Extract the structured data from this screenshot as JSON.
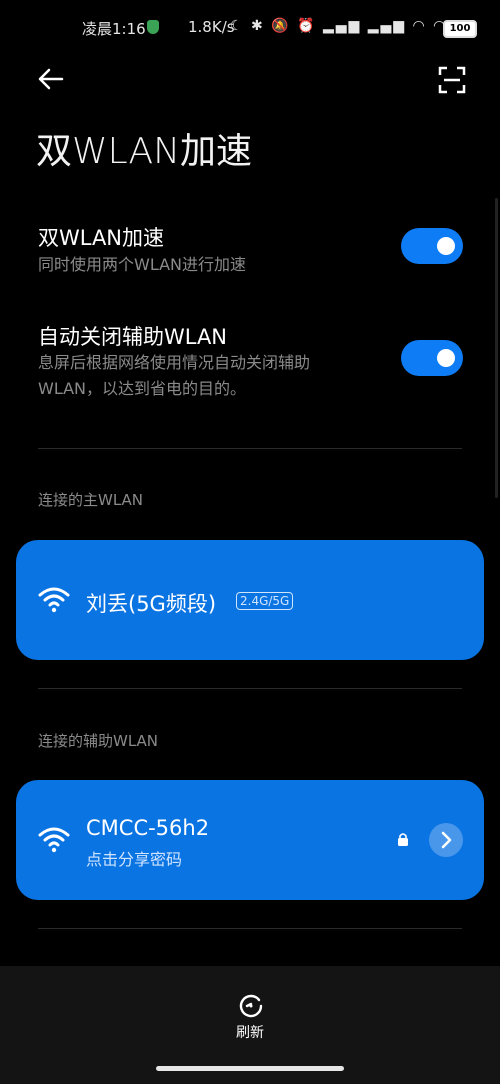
{
  "status_bar": {
    "time": "凌晨1:16",
    "net_speed": "1.8K/s",
    "battery": "100"
  },
  "page": {
    "title": "双WLAN加速"
  },
  "settings": [
    {
      "title": "双WLAN加速",
      "subtitle": "同时使用两个WLAN进行加速",
      "enabled": true
    },
    {
      "title": "自动关闭辅助WLAN",
      "subtitle": "息屏后根据网络使用情况自动关闭辅助WLAN，以达到省电的目的。",
      "enabled": true
    }
  ],
  "primary": {
    "section_label": "连接的主WLAN",
    "ssid": "刘丢(5G频段)",
    "band_tag": "2.4G/5G"
  },
  "secondary": {
    "section_label": "连接的辅助WLAN",
    "ssid": "CMCC-56h2",
    "hint": "点击分享密码"
  },
  "toolbar": {
    "refresh_label": "刷新"
  },
  "colors": {
    "accent": "#0b74e3",
    "toggle_on": "#0e7cf4",
    "background": "#000000"
  }
}
